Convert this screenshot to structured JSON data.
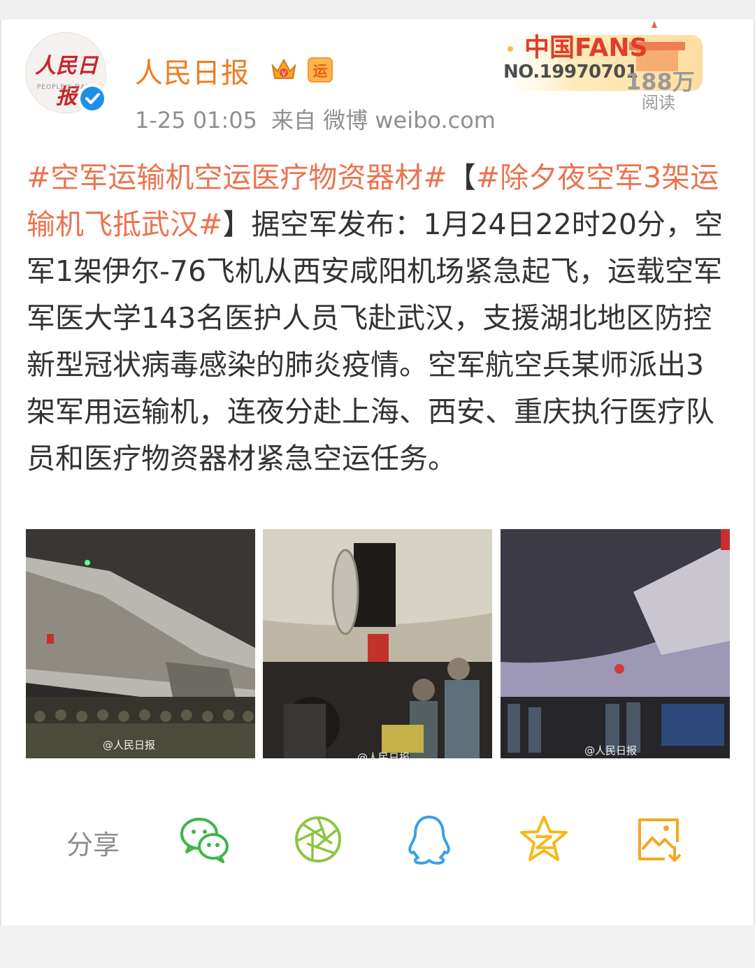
{
  "post": {
    "author": "人民日报",
    "avatar_text": "人民日报",
    "avatar_subtext": "PEOPLE'S DAILY",
    "badge_yun": "运",
    "time": "1-25 01:05",
    "source": "来自 微博 weibo.com",
    "fans_banner": {
      "brand": "中国FANS",
      "number": "NO.19970701",
      "read_count": "188万",
      "read_label": "阅读"
    },
    "content": {
      "tag1": "#空军运输机空运医疗物资器材#",
      "bracket_open": "【",
      "tag2": "#除夕夜空军3架运输机飞抵武汉#",
      "bracket_close": "】",
      "text": "据空军发布：1月24日22时20分，空军1架伊尔-76飞机从西安咸阳机场紧急起飞，运载空军军医大学143名医护人员飞赴武汉，支援湖北地区防控新型冠状病毒感染的肺炎疫情。空军航空兵某师派出3架军用运输机，连夜分赴上海、西安、重庆执行医疗队员和医疗物资器材紧急空运任务。"
    },
    "images": [
      {
        "watermark": "@人民日报"
      },
      {
        "watermark": "@人民日报"
      },
      {
        "watermark": "@人民日报"
      }
    ]
  },
  "share": {
    "label": "分享",
    "targets": [
      {
        "icon": "wechat-icon"
      },
      {
        "icon": "moments-icon"
      },
      {
        "icon": "qq-icon"
      },
      {
        "icon": "qzone-icon"
      },
      {
        "icon": "save-image-icon"
      }
    ]
  },
  "colors": {
    "author": "#f07c1e",
    "hashtag": "#eb7350",
    "link_tag": "#4c82c9",
    "wechat": "#3fb44a",
    "moments": "#8cc63f",
    "qq": "#3aa0e8",
    "qzone": "#f5b916",
    "save": "#f5a623"
  }
}
